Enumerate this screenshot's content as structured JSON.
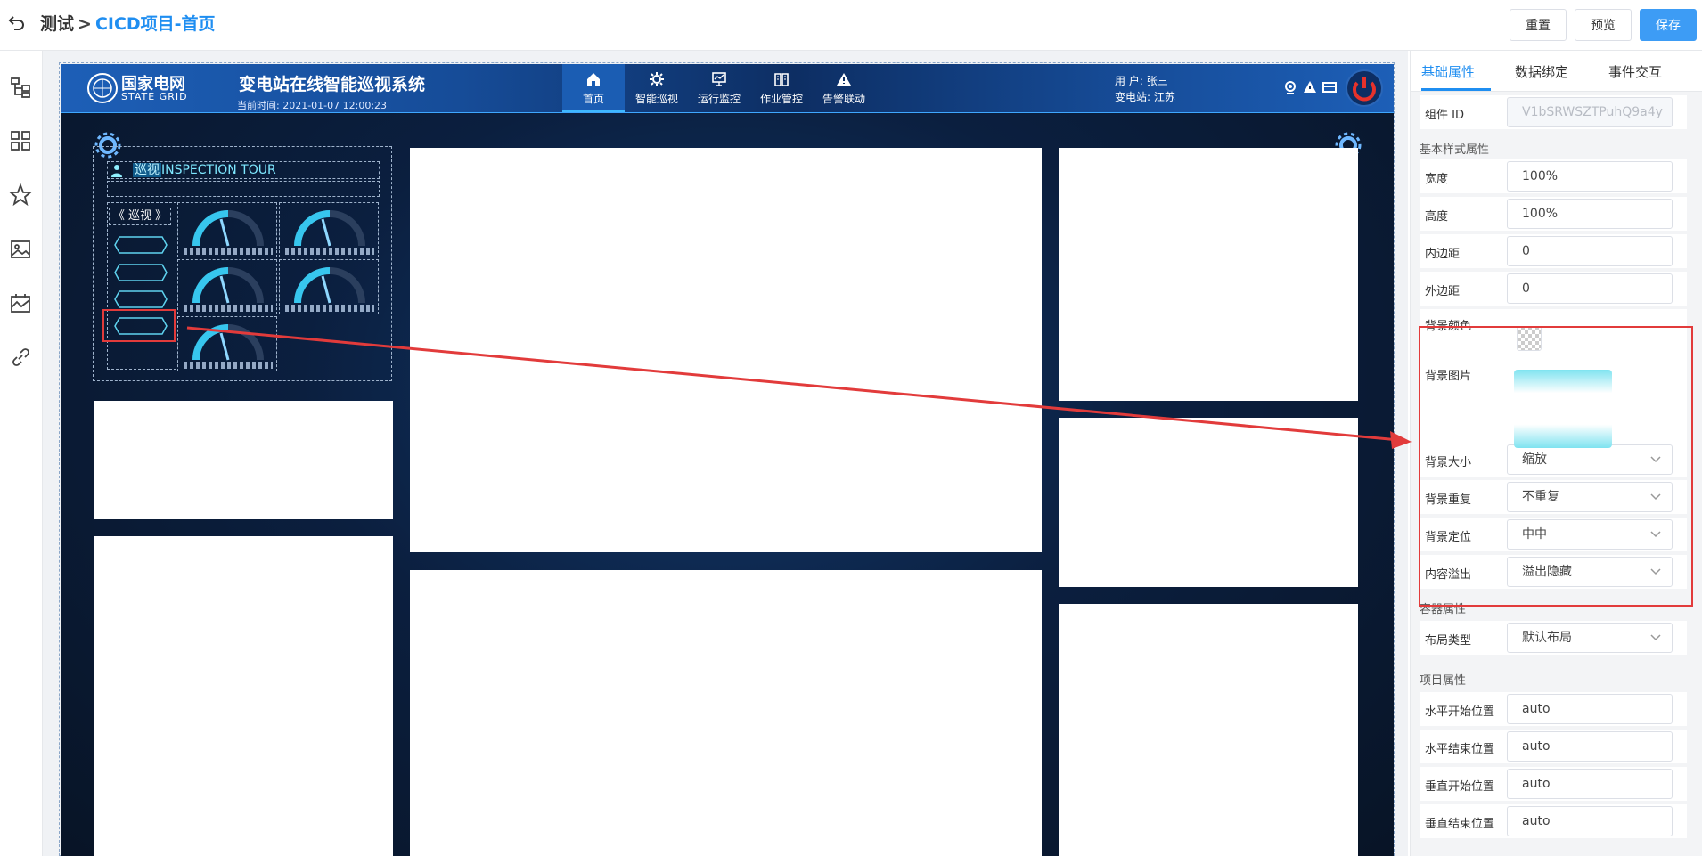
{
  "topbar": {
    "back_icon": "undo-icon",
    "breadcrumb_root": "测试",
    "breadcrumb_sep": ">",
    "breadcrumb_current": "CICD项目-首页",
    "buttons": {
      "reset": "重置",
      "preview": "预览",
      "save": "保存"
    },
    "accent_color": "#3d9cf5"
  },
  "left_toolbar": {
    "icons": [
      "tree-icon",
      "grid-icon",
      "star-icon",
      "image-icon",
      "chart-image-icon",
      "link-icon"
    ]
  },
  "screen": {
    "logo_cn": "国家电网",
    "logo_en": "STATE GRID",
    "system_title": "变电站在线智能巡视系统",
    "time_label": "当前时间:",
    "time_value": "2021-01-07  12:00:23",
    "nav": [
      {
        "label": "首页",
        "icon": "home-icon",
        "active": true
      },
      {
        "label": "智能巡视",
        "icon": "gear-icon",
        "active": false
      },
      {
        "label": "运行监控",
        "icon": "monitor-icon",
        "active": false
      },
      {
        "label": "作业管控",
        "icon": "book-icon",
        "active": false
      },
      {
        "label": "告警联动",
        "icon": "warning-icon",
        "active": false
      }
    ],
    "user_label": "用    户:",
    "user_value": "张三",
    "station_label": "变电站:",
    "station_value": "江苏",
    "inspection_title_zh": "巡视",
    "inspection_title_en": "INSPECTION TOUR",
    "inspection_button": "《 巡视 》"
  },
  "right_panel": {
    "tabs": [
      "基础属性",
      "数据绑定",
      "事件交互"
    ],
    "component_id_label": "组件 ID",
    "component_id_value": "V1bSRWSZTPuhQ9a4y",
    "section_basic": "基本样式属性",
    "width_label": "宽度",
    "width_value": "100%",
    "height_label": "高度",
    "height_value": "100%",
    "padding_label": "内边距",
    "padding_value": "0",
    "margin_label": "外边距",
    "margin_value": "0",
    "bg_color_label": "背景颜色",
    "bg_image_label": "背景图片",
    "bg_size_label": "背景大小",
    "bg_size_value": "缩放",
    "bg_repeat_label": "背景重复",
    "bg_repeat_value": "不重复",
    "bg_position_label": "背景定位",
    "bg_position_value": "中中",
    "overflow_label": "内容溢出",
    "overflow_value": "溢出隐藏",
    "section_container": "容器属性",
    "layout_label": "布局类型",
    "layout_value": "默认布局",
    "section_item": "项目属性",
    "col_start_label": "水平开始位置",
    "col_start_value": "auto",
    "col_end_label": "水平结束位置",
    "col_end_value": "auto",
    "row_start_label": "垂直开始位置",
    "row_start_value": "auto",
    "row_end_label": "垂直结束位置",
    "row_end_value": "auto"
  },
  "annotation_color": "#e23b3b"
}
